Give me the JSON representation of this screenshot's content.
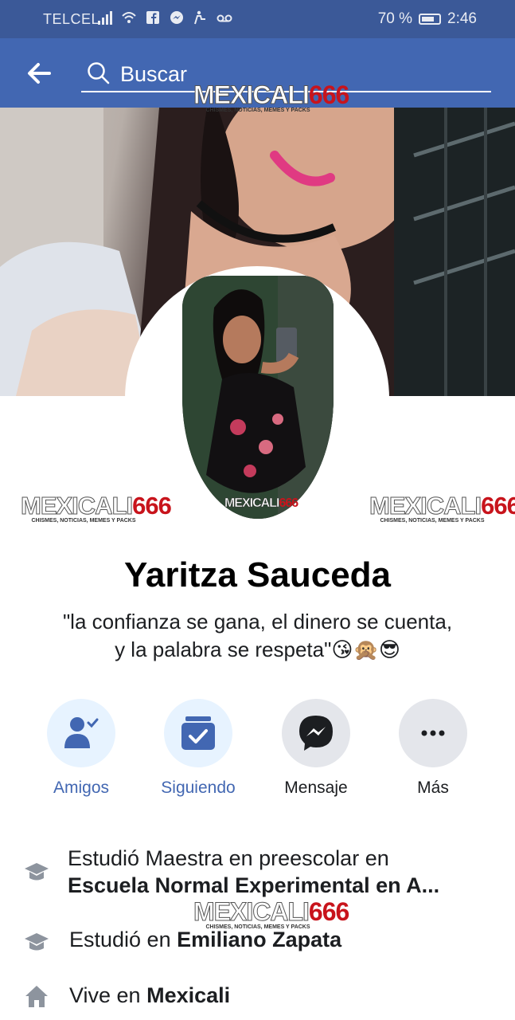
{
  "status_bar": {
    "carrier": "TELCEL",
    "battery": "70 %",
    "time": "2:46",
    "icons": [
      "signal-icon",
      "wifi-icon",
      "facebook-icon",
      "messenger-icon",
      "accessibility-icon",
      "voicemail-icon"
    ]
  },
  "app_bar": {
    "back_icon": "arrow-left-icon",
    "search_label": "Buscar"
  },
  "watermark": {
    "brand_main": "MEXICALI",
    "brand_num": "666",
    "tagline": "CHISMES, NOTICIAS, MEMES Y PACKS"
  },
  "profile": {
    "name": "Yaritza Sauceda",
    "bio_line1": "\"la confianza se gana, el dinero se cuenta,",
    "bio_line2": "y la palabra se respeta\"😘🙊😎"
  },
  "actions": [
    {
      "label": "Amigos",
      "icon": "friends-check-icon",
      "color": "#4267b2"
    },
    {
      "label": "Siguiendo",
      "icon": "following-check-icon",
      "color": "#4267b2"
    },
    {
      "label": "Mensaje",
      "icon": "messenger-icon",
      "color": "#1c1e21"
    },
    {
      "label": "Más",
      "icon": "more-dots-icon",
      "color": "#1c1e21"
    }
  ],
  "info": [
    {
      "icon": "education-icon",
      "prefix": "Estudió Maestra en preescolar en",
      "bold": "Escuela Normal Experimental en A..."
    },
    {
      "icon": "education-icon",
      "prefix": "Estudió en ",
      "bold": "Emiliano Zapata"
    },
    {
      "icon": "home-icon",
      "prefix": "Vive en ",
      "bold": "Mexicali"
    }
  ],
  "colors": {
    "status_bar": "#3b5998",
    "app_bar": "#4267b2",
    "accent": "#4267b2",
    "action_bg_blue": "#e7f3ff",
    "action_bg_gray": "#e4e6eb"
  }
}
